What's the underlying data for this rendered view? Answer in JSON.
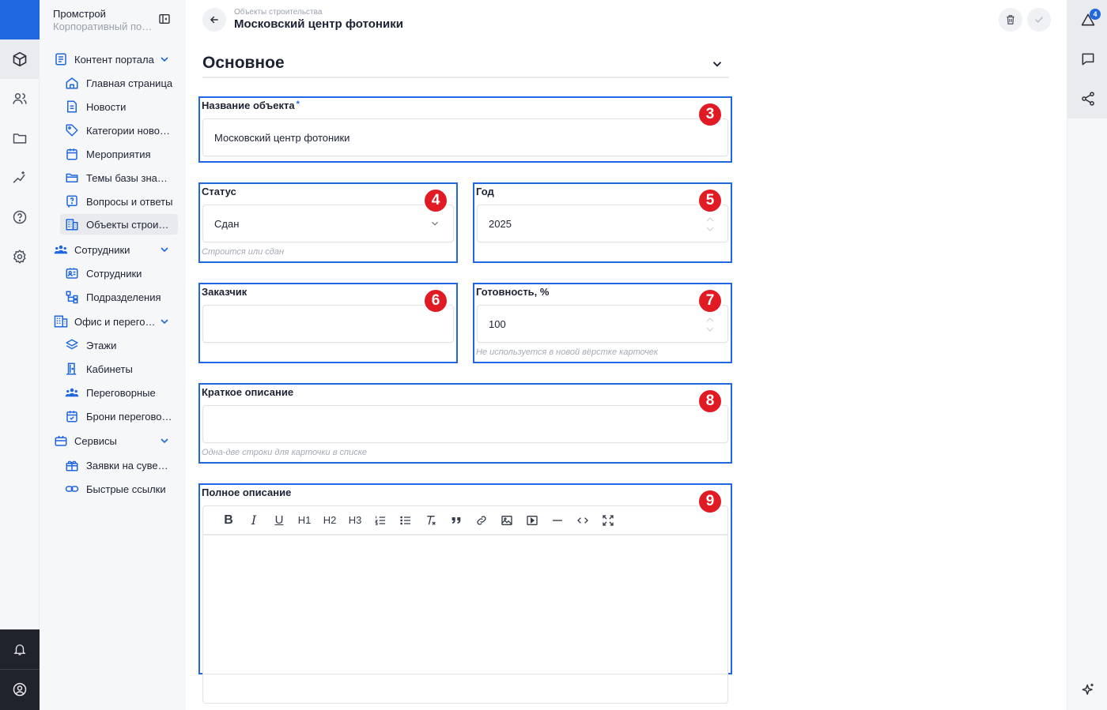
{
  "app": {
    "name": "Промстрой",
    "subtitle": "Корпоративный портал"
  },
  "sidebar": {
    "groups": [
      {
        "label": "Контент портала",
        "items": [
          {
            "label": "Главная страница",
            "icon": "home-icon"
          },
          {
            "label": "Новости",
            "icon": "news-icon"
          },
          {
            "label": "Категории новостей",
            "icon": "tag-icon"
          },
          {
            "label": "Мероприятия",
            "icon": "calendar-icon"
          },
          {
            "label": "Темы базы знаний",
            "icon": "folder-icon"
          },
          {
            "label": "Вопросы и ответы",
            "icon": "question-icon"
          },
          {
            "label": "Объекты строительства",
            "icon": "building-icon",
            "active": true
          }
        ]
      },
      {
        "label": "Сотрудники",
        "items": [
          {
            "label": "Сотрудники",
            "icon": "contact-card-icon"
          },
          {
            "label": "Подразделения",
            "icon": "org-chart-icon"
          }
        ]
      },
      {
        "label": "Офис и переговорные",
        "items": [
          {
            "label": "Этажи",
            "icon": "layers-icon"
          },
          {
            "label": "Кабинеты",
            "icon": "door-icon"
          },
          {
            "label": "Переговорные",
            "icon": "people-icon"
          },
          {
            "label": "Брони переговорных",
            "icon": "calendar-check-icon"
          }
        ]
      },
      {
        "label": "Сервисы",
        "items": [
          {
            "label": "Заявки на сувениры",
            "icon": "gift-icon"
          },
          {
            "label": "Быстрые ссылки",
            "icon": "link-icon"
          }
        ]
      }
    ]
  },
  "header": {
    "breadcrumb": "Объекты строительства",
    "title": "Московский центр фотоники"
  },
  "section": {
    "title": "Основное"
  },
  "form": {
    "name": {
      "label": "Название объекта",
      "required_mark": "*",
      "value": "Московский центр фотоники",
      "badge": "3"
    },
    "status": {
      "label": "Статус",
      "value": "Сдан",
      "hint": "Строится или сдан",
      "badge": "4"
    },
    "year": {
      "label": "Год",
      "value": "2025",
      "badge": "5"
    },
    "customer": {
      "label": "Заказчик",
      "value": "",
      "badge": "6"
    },
    "readiness": {
      "label": "Готовность, %",
      "value": "100",
      "hint": "Не используется в новой вёрстке карточек",
      "badge": "7"
    },
    "short_desc": {
      "label": "Краткое описание",
      "value": "",
      "hint": "Одна-две строки для карточки в списке",
      "badge": "8"
    },
    "full_desc": {
      "label": "Полное описание",
      "badge": "9",
      "toolbar": [
        "B",
        "I",
        "U",
        "H1",
        "H2",
        "H3"
      ]
    }
  },
  "notifications": {
    "count": "4"
  },
  "colors": {
    "accent": "#1f67e0",
    "badge": "#e01b24",
    "highlight_border": "#1f67e0"
  }
}
